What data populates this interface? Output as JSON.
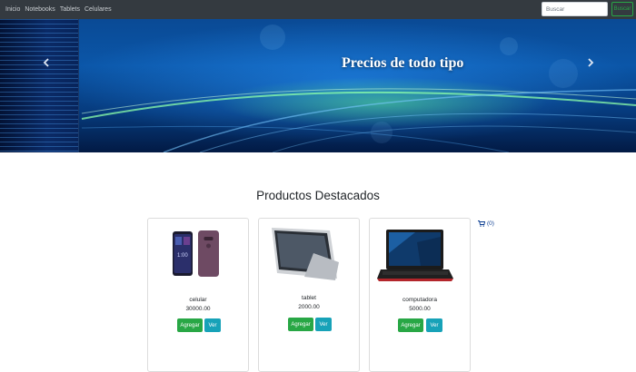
{
  "navbar": {
    "links": [
      "Inicio",
      "Notebooks",
      "Tablets",
      "Celulares"
    ],
    "search": {
      "placeholder": "Buscar",
      "button_label": "Buscar"
    }
  },
  "carousel": {
    "caption": "Precios de todo tipo",
    "prev_icon": "chevron-left-icon",
    "next_icon": "chevron-right-icon"
  },
  "main": {
    "title": "Productos Destacados",
    "cart": {
      "icon": "shopping-cart-icon",
      "count_label": "(0)"
    },
    "products": [
      {
        "name": "celular",
        "price": "30000.00",
        "image": "smartphone-image",
        "add_label": "Agregar",
        "view_label": "Ver"
      },
      {
        "name": "tablet",
        "price": "2000.00",
        "image": "tablet-image",
        "add_label": "Agregar",
        "view_label": "Ver"
      },
      {
        "name": "computadora",
        "price": "5000.00",
        "image": "laptop-image",
        "add_label": "Agregar",
        "view_label": "Ver"
      }
    ]
  },
  "colors": {
    "navbar": "#343a40",
    "success": "#28a745",
    "info": "#17a2b8",
    "cart": "#0b3d91"
  }
}
